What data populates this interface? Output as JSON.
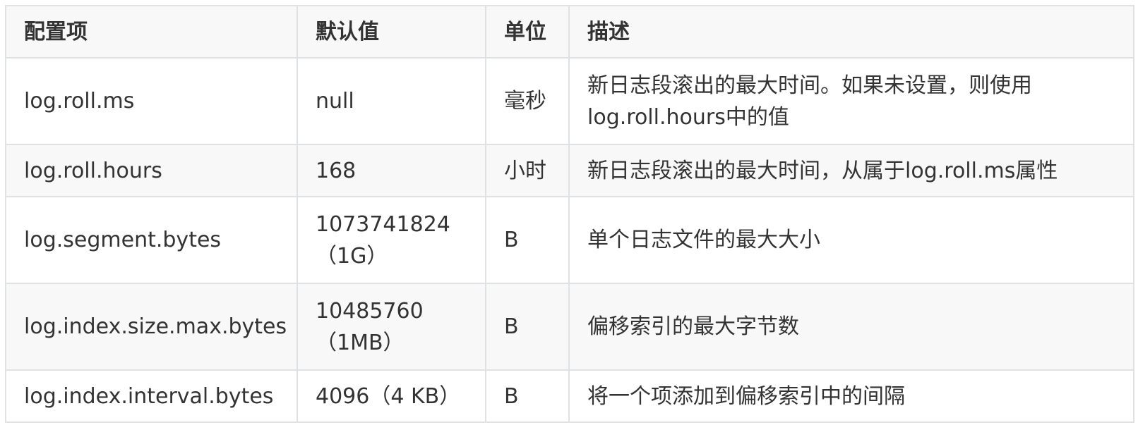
{
  "table": {
    "headers": [
      "配置项",
      "默认值",
      "单位",
      "描述"
    ],
    "rows": [
      {
        "name": "log.roll.ms",
        "default": [
          "null"
        ],
        "unit": "毫秒",
        "desc": [
          "新日志段滚出的最大时间。如果未设置，则使用",
          "log.roll.hours中的值"
        ]
      },
      {
        "name": "log.roll.hours",
        "default": [
          "168"
        ],
        "unit": "小时",
        "desc": [
          "新日志段滚出的最大时间，从属于log.roll.ms属性"
        ]
      },
      {
        "name": "log.segment.bytes",
        "default": [
          "1073741824",
          "（1G）"
        ],
        "unit": "B",
        "desc": [
          "单个日志文件的最大大小"
        ]
      },
      {
        "name": "log.index.size.max.bytes",
        "default": [
          "10485760",
          "（1MB）"
        ],
        "unit": "B",
        "desc": [
          "偏移索引的最大字节数"
        ]
      },
      {
        "name": "log.index.interval.bytes",
        "default": [
          "4096（4 KB）"
        ],
        "unit": "B",
        "desc": [
          "将一个项添加到偏移索引中的间隔"
        ]
      }
    ]
  },
  "colors": {
    "border": "#dfe2e5",
    "stripe": "#f8f8f8",
    "text": "#333333"
  }
}
